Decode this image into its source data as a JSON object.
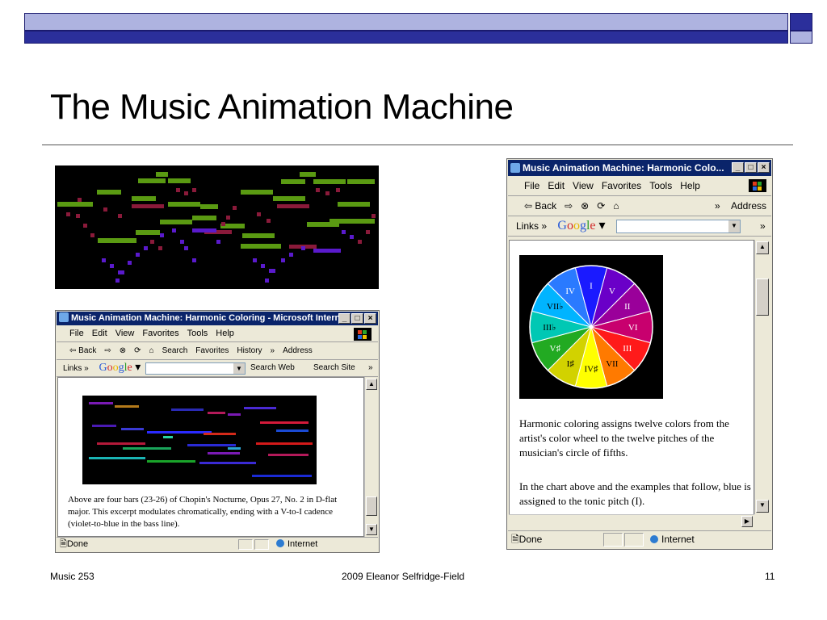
{
  "slide": {
    "title": "The Music Animation Machine",
    "footer_left": "Music 253",
    "footer_center": "2009 Eleanor Selfridge-Field",
    "footer_right": "11"
  },
  "colors": {
    "title_bar": "#0a246a",
    "accent_light": "#aeb3e0",
    "accent_dark": "#2b2f9b",
    "roll_background": "#000000"
  },
  "window_small": {
    "title": "Music Animation Machine: Harmonic Coloring - Microsoft Internet Ex...",
    "menu": [
      "File",
      "Edit",
      "View",
      "Favorites",
      "Tools",
      "Help"
    ],
    "toolbar": [
      "⇦ Back",
      "⇨",
      "Search",
      "Favorites",
      "History",
      "»",
      "Address"
    ],
    "links_label": "Links »",
    "google": [
      "G",
      "o",
      "o",
      "g",
      "l",
      "e"
    ],
    "search_web": "Search Web",
    "search_site": "Search Site",
    "more": "»",
    "caption": "Above are four bars (23-26) of Chopin's Nocturne, Opus 27, No. 2 in D-flat major. This excerpt modulates chromatically, ending with a V-to-I cadence (violet-to-blue in the bass line).",
    "status_done": "Done",
    "status_zone": "Internet"
  },
  "window_large": {
    "title": "Music Animation Machine: Harmonic Colo...",
    "menu": [
      "File",
      "Edit",
      "View",
      "Favorites",
      "Tools",
      "Help"
    ],
    "toolbar": [
      "⇦ Back",
      "⇨"
    ],
    "more": "»",
    "address_label": "Address",
    "links_label": "Links »",
    "google": [
      "G",
      "o",
      "o",
      "g",
      "l",
      "e"
    ],
    "para1": "Harmonic coloring assigns twelve colors from the artist's color wheel to the twelve pitches of the musician's circle of fifths.",
    "para2": "In the chart above and the examples that follow, blue is assigned to the tonic pitch (I).",
    "status_done": "Done",
    "status_zone": "Internet"
  },
  "color_wheel": {
    "labels": [
      "I",
      "V",
      "II",
      "VI",
      "III",
      "VII",
      "IV♯",
      "I♯",
      "V♯",
      "III♭",
      "VII♭",
      "IV"
    ],
    "colors": [
      "#1a1aff",
      "#6a00c8",
      "#9a009a",
      "#c8006e",
      "#ff1a1a",
      "#ff7a00",
      "#ffff00",
      "#d2d200",
      "#22aa22",
      "#00c8b4",
      "#00b4ff",
      "#2a7aff"
    ]
  }
}
